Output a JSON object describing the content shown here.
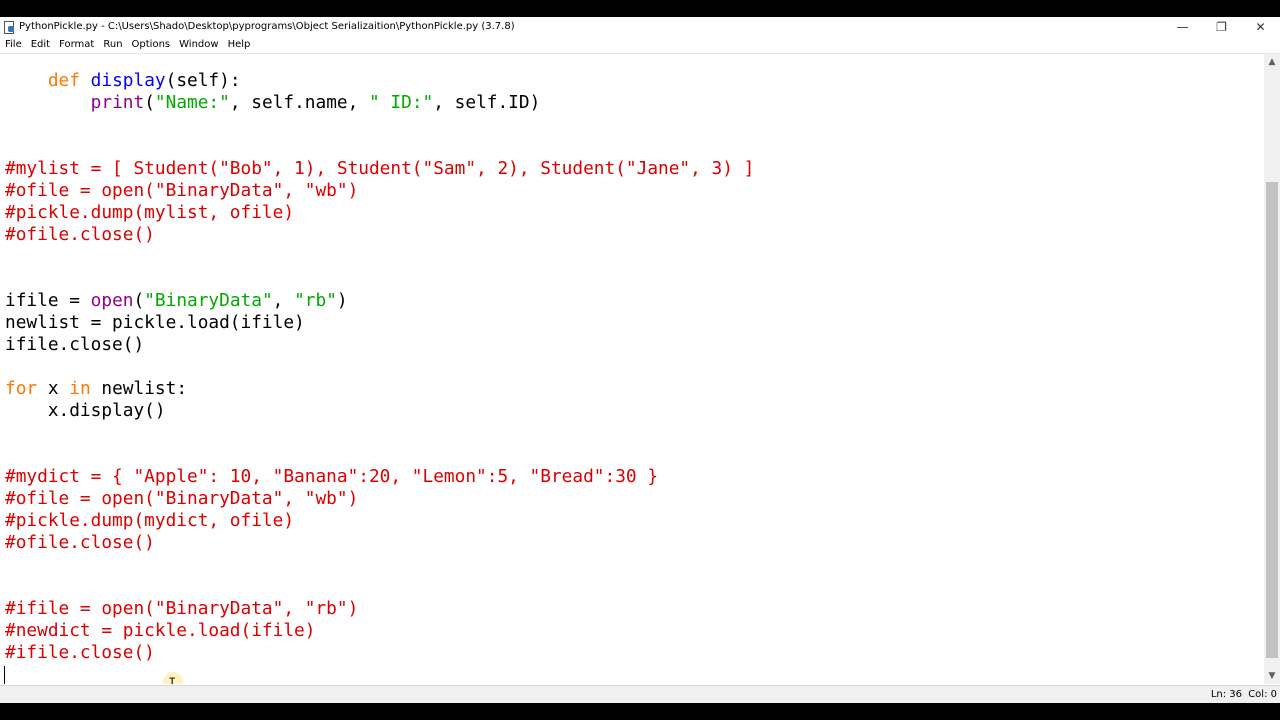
{
  "window": {
    "title": "PythonPickle.py - C:\\Users\\Shado\\Desktop\\pyprograms\\Object Serializaition\\PythonPickle.py (3.7.8)",
    "minimize_glyph": "—",
    "maximize_glyph": "❐",
    "close_glyph": "✕"
  },
  "menu": {
    "items": [
      "File",
      "Edit",
      "Format",
      "Run",
      "Options",
      "Window",
      "Help"
    ]
  },
  "editor": {
    "language": "Python",
    "lines": [
      {
        "tokens": [
          {
            "t": "    "
          },
          {
            "t": "def",
            "c": "kw"
          },
          {
            "t": " "
          },
          {
            "t": "display",
            "c": "def"
          },
          {
            "t": "(self):"
          }
        ]
      },
      {
        "tokens": [
          {
            "t": "        "
          },
          {
            "t": "print",
            "c": "bi"
          },
          {
            "t": "("
          },
          {
            "t": "\"Name:\"",
            "c": "str"
          },
          {
            "t": ", self.name, "
          },
          {
            "t": "\" ID:\"",
            "c": "str"
          },
          {
            "t": ", self.ID)"
          }
        ]
      },
      {
        "tokens": []
      },
      {
        "tokens": []
      },
      {
        "tokens": [
          {
            "t": "#mylist = [ Student(\"Bob\", 1), Student(\"Sam\", 2), Student(\"Jane\", 3) ]",
            "c": "cmt"
          }
        ]
      },
      {
        "tokens": [
          {
            "t": "#ofile = open(\"BinaryData\", \"wb\")",
            "c": "cmt"
          }
        ]
      },
      {
        "tokens": [
          {
            "t": "#pickle.dump(mylist, ofile)",
            "c": "cmt"
          }
        ]
      },
      {
        "tokens": [
          {
            "t": "#ofile.close()",
            "c": "cmt"
          }
        ]
      },
      {
        "tokens": []
      },
      {
        "tokens": []
      },
      {
        "tokens": [
          {
            "t": "ifile = "
          },
          {
            "t": "open",
            "c": "bi"
          },
          {
            "t": "("
          },
          {
            "t": "\"BinaryData\"",
            "c": "str"
          },
          {
            "t": ", "
          },
          {
            "t": "\"rb\"",
            "c": "str"
          },
          {
            "t": ")"
          }
        ]
      },
      {
        "tokens": [
          {
            "t": "newlist = pickle.load(ifile)"
          }
        ]
      },
      {
        "tokens": [
          {
            "t": "ifile.close()"
          }
        ]
      },
      {
        "tokens": []
      },
      {
        "tokens": [
          {
            "t": "for",
            "c": "kw"
          },
          {
            "t": " x "
          },
          {
            "t": "in",
            "c": "kw"
          },
          {
            "t": " newlist:"
          }
        ]
      },
      {
        "tokens": [
          {
            "t": "    x.display()"
          }
        ]
      },
      {
        "tokens": []
      },
      {
        "tokens": []
      },
      {
        "tokens": [
          {
            "t": "#mydict = { \"Apple\": 10, \"Banana\":20, \"Lemon\":5, \"Bread\":30 }",
            "c": "cmt"
          }
        ]
      },
      {
        "tokens": [
          {
            "t": "#ofile = open(\"BinaryData\", \"wb\")",
            "c": "cmt"
          }
        ]
      },
      {
        "tokens": [
          {
            "t": "#pickle.dump(mydict, ofile)",
            "c": "cmt"
          }
        ]
      },
      {
        "tokens": [
          {
            "t": "#ofile.close()",
            "c": "cmt"
          }
        ]
      },
      {
        "tokens": []
      },
      {
        "tokens": []
      },
      {
        "tokens": [
          {
            "t": "#ifile = open(\"BinaryData\", \"rb\")",
            "c": "cmt"
          }
        ]
      },
      {
        "tokens": [
          {
            "t": "#newdict = pickle.load(ifile)",
            "c": "cmt"
          }
        ]
      },
      {
        "tokens": [
          {
            "t": "#ifile.close()",
            "c": "cmt"
          }
        ]
      },
      {
        "tokens": []
      }
    ],
    "cursor_glyph": "I",
    "colors": {
      "keyword": "#ff7700",
      "builtin": "#900090",
      "definition": "#0000ff",
      "string": "#00aa00",
      "comment": "#dd0000"
    }
  },
  "scrollbar": {
    "up_glyph": "▲",
    "down_glyph": "▼"
  },
  "status": {
    "line": "Ln: 36",
    "col": "Col: 0"
  }
}
